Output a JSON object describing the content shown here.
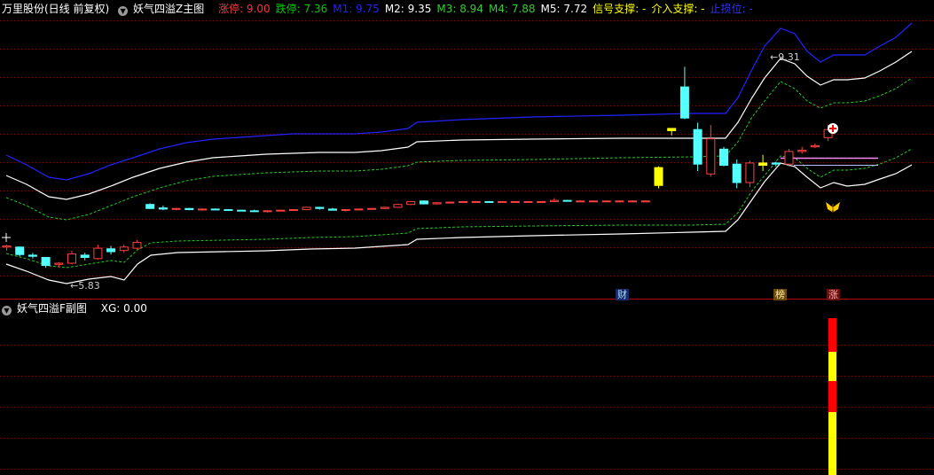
{
  "main_header": {
    "stock": "万里股份(日线 前复权)",
    "indicator": "妖气四溢Z主图",
    "items": [
      {
        "label": "涨停: ",
        "value": "9.00",
        "color": "#ff3333"
      },
      {
        "label": "跌停: ",
        "value": "7.36",
        "color": "#00cc00"
      },
      {
        "label": "M1: ",
        "value": "9.75",
        "color": "#2222ff"
      },
      {
        "label": "M2: ",
        "value": "9.35",
        "color": "#ffffff"
      },
      {
        "label": "M3: ",
        "value": "8.94",
        "color": "#33cc33"
      },
      {
        "label": "M4: ",
        "value": "7.88",
        "color": "#33cc33"
      },
      {
        "label": "M5: ",
        "value": "7.72",
        "color": "#ffffff"
      },
      {
        "label": "信号支撑: ",
        "value": "-",
        "color": "#ffff00"
      },
      {
        "label": "介入支撑: ",
        "value": "-",
        "color": "#ffff00"
      },
      {
        "label": "止损位: ",
        "value": "-",
        "color": "#3333ff"
      }
    ]
  },
  "sub_header": {
    "indicator": "妖气四溢F副图",
    "label": "XG: ",
    "value": "0.00"
  },
  "annotations": {
    "high": "9.31",
    "low": "5.83"
  },
  "tags": {
    "cai": "财",
    "bang": "榜",
    "zhang": "涨"
  },
  "colors": {
    "up": "#ff4040",
    "down": "#54ffff",
    "yellow": "#ffff00",
    "grid": "#8b0000",
    "m1": "#2222ff",
    "white": "#ffffff",
    "dash": "#22cc22"
  },
  "icons": [
    "circle-plus-icon",
    "butterfly-icon",
    "collapse-triangle-icon"
  ],
  "chart_data": {
    "type": "candlestick",
    "candles": [
      [
        6.18,
        6.22,
        6.12,
        6.2
      ],
      [
        6.18,
        6.19,
        6.02,
        6.05
      ],
      [
        6.04,
        6.08,
        5.98,
        6.02
      ],
      [
        6.0,
        6.01,
        5.82,
        5.86
      ],
      [
        5.88,
        5.92,
        5.83,
        5.9
      ],
      [
        5.9,
        6.12,
        5.88,
        6.06
      ],
      [
        6.04,
        6.08,
        5.95,
        6.0
      ],
      [
        5.98,
        6.22,
        5.96,
        6.16
      ],
      [
        6.15,
        6.2,
        6.05,
        6.1
      ],
      [
        6.12,
        6.22,
        6.08,
        6.18
      ],
      [
        6.16,
        6.3,
        6.14,
        6.26
      ],
      [
        6.92,
        6.94,
        6.84,
        6.85
      ],
      [
        6.86,
        6.9,
        6.82,
        6.84
      ],
      [
        6.84,
        6.86,
        6.82,
        6.85
      ],
      [
        6.85,
        6.86,
        6.82,
        6.83
      ],
      [
        6.83,
        6.85,
        6.81,
        6.84
      ],
      [
        6.84,
        6.85,
        6.82,
        6.83
      ],
      [
        6.83,
        6.84,
        6.81,
        6.82
      ],
      [
        6.82,
        6.83,
        6.8,
        6.81
      ],
      [
        6.81,
        6.83,
        6.79,
        6.8
      ],
      [
        6.8,
        6.82,
        6.78,
        6.81
      ],
      [
        6.81,
        6.83,
        6.8,
        6.82
      ],
      [
        6.82,
        6.84,
        6.81,
        6.83
      ],
      [
        6.83,
        6.88,
        6.82,
        6.87
      ],
      [
        6.87,
        6.88,
        6.83,
        6.85
      ],
      [
        6.84,
        6.86,
        6.83,
        6.82
      ],
      [
        6.82,
        6.84,
        6.8,
        6.83
      ],
      [
        6.83,
        6.85,
        6.82,
        6.84
      ],
      [
        6.84,
        6.86,
        6.83,
        6.85
      ],
      [
        6.85,
        6.88,
        6.84,
        6.87
      ],
      [
        6.87,
        6.93,
        6.86,
        6.92
      ],
      [
        6.92,
        6.98,
        6.91,
        6.97
      ],
      [
        6.98,
        6.99,
        6.92,
        6.93
      ],
      [
        6.93,
        6.96,
        6.92,
        6.95
      ],
      [
        6.95,
        6.97,
        6.94,
        6.96
      ],
      [
        6.96,
        6.98,
        6.95,
        6.97
      ],
      [
        6.97,
        6.98,
        6.96,
        6.97
      ],
      [
        6.97,
        6.98,
        6.96,
        6.96
      ],
      [
        6.96,
        6.98,
        6.95,
        6.97
      ],
      [
        6.97,
        6.98,
        6.96,
        6.97
      ],
      [
        6.97,
        6.98,
        6.96,
        6.97
      ],
      [
        6.97,
        6.98,
        6.96,
        6.97
      ],
      [
        6.97,
        7.03,
        6.96,
        6.99
      ],
      [
        6.99,
        7.0,
        6.97,
        6.98
      ],
      [
        6.98,
        6.99,
        6.97,
        6.98
      ],
      [
        6.98,
        6.99,
        6.97,
        6.98
      ],
      [
        6.98,
        6.99,
        6.97,
        6.98
      ],
      [
        6.98,
        6.99,
        6.97,
        6.98
      ],
      [
        6.98,
        6.99,
        6.97,
        6.98
      ],
      [
        6.98,
        6.99,
        6.97,
        6.98
      ],
      [
        7.56,
        7.58,
        7.2,
        7.25
      ],
      [
        8.2,
        8.24,
        8.12,
        8.24
      ],
      [
        8.96,
        9.31,
        8.4,
        8.42
      ],
      [
        8.22,
        8.34,
        7.5,
        7.62
      ],
      [
        7.45,
        8.3,
        7.4,
        8.06
      ],
      [
        7.88,
        7.92,
        7.58,
        7.6
      ],
      [
        7.62,
        7.7,
        7.2,
        7.3
      ],
      [
        7.3,
        7.68,
        7.22,
        7.64
      ],
      [
        7.6,
        7.78,
        7.5,
        7.64
      ],
      [
        7.64,
        7.66,
        7.58,
        7.62
      ],
      [
        7.62,
        7.88,
        7.58,
        7.84
      ],
      [
        7.84,
        7.92,
        7.8,
        7.86
      ],
      [
        7.92,
        7.98,
        7.9,
        7.94
      ],
      [
        8.08,
        8.3,
        8.02,
        8.22
      ]
    ]
  }
}
